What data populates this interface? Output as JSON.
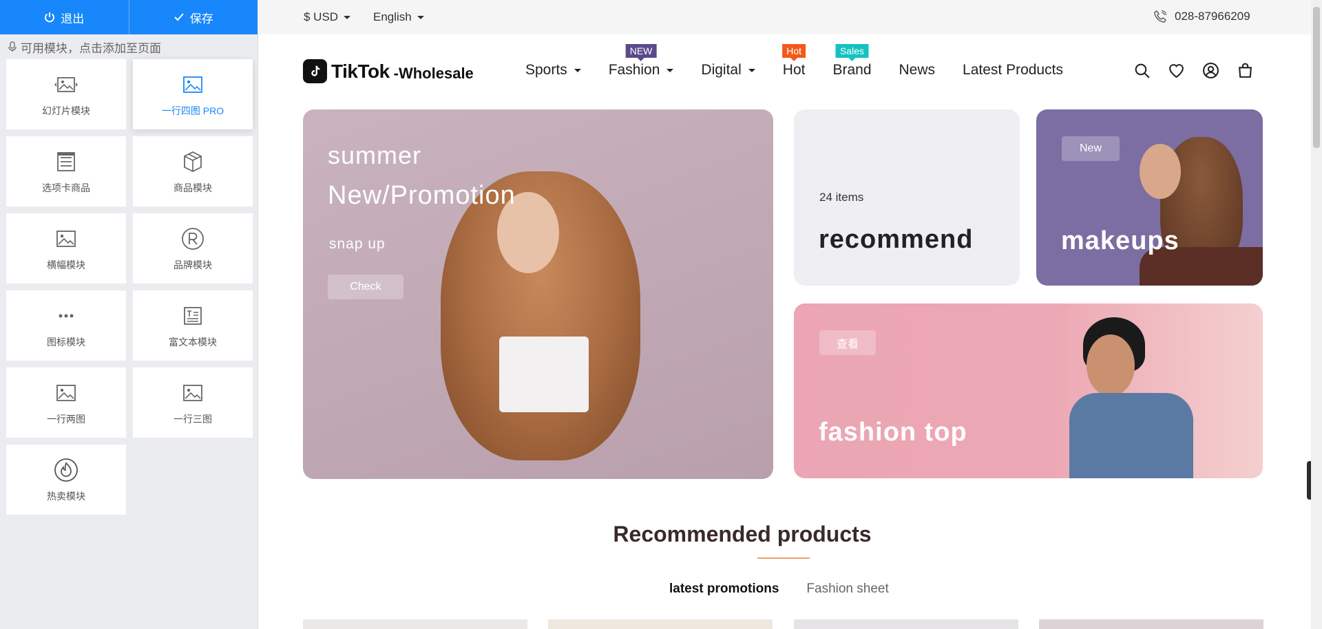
{
  "left_panel": {
    "exit_label": "退出",
    "save_label": "保存",
    "hint": "可用模块，点击添加至页面",
    "modules": [
      {
        "label": "幻灯片模块",
        "icon": "slideshow-icon"
      },
      {
        "label": "一行四图 PRO",
        "icon": "image-icon",
        "active": true
      },
      {
        "label": "选项卡商品",
        "icon": "list-icon"
      },
      {
        "label": "商品模块",
        "icon": "box-icon"
      },
      {
        "label": "横幅模块",
        "icon": "image-icon"
      },
      {
        "label": "品牌模块",
        "icon": "registered-icon"
      },
      {
        "label": "图标模块",
        "icon": "dots-icon"
      },
      {
        "label": "富文本模块",
        "icon": "richtext-icon"
      },
      {
        "label": "一行两图",
        "icon": "image-icon"
      },
      {
        "label": "一行三图",
        "icon": "image-icon"
      },
      {
        "label": "热卖模块",
        "icon": "fire-icon"
      }
    ]
  },
  "topbar": {
    "currency": "$ USD",
    "language": "English",
    "phone": "028-87966209"
  },
  "header": {
    "logo_brand": "TikTok",
    "logo_sub": "-Wholesale",
    "nav": [
      {
        "label": "Sports",
        "dropdown": true
      },
      {
        "label": "Fashion",
        "dropdown": true,
        "badge": "NEW",
        "badge_color": "#5a4a8a"
      },
      {
        "label": "Digital",
        "dropdown": true
      },
      {
        "label": "Hot",
        "badge": "Hot",
        "badge_color": "#f25a1a"
      },
      {
        "label": "Brand",
        "badge": "Sales",
        "badge_color": "#13c2c2"
      },
      {
        "label": "News"
      },
      {
        "label": "Latest Products"
      }
    ]
  },
  "banners": {
    "main": {
      "line1": "summer",
      "line2": "New/Promotion",
      "sub": "snap up",
      "button": "Check"
    },
    "recommend": {
      "count": "24 items",
      "title": "recommend"
    },
    "makeups": {
      "tag": "New",
      "title": "makeups"
    },
    "fashion": {
      "button": "查看",
      "title": "fashion top"
    }
  },
  "section": {
    "title": "Recommended products",
    "tabs": [
      "latest promotions",
      "Fashion sheet"
    ]
  },
  "colors": {
    "primary": "#1787fb",
    "accent_line": "#f0a070"
  }
}
